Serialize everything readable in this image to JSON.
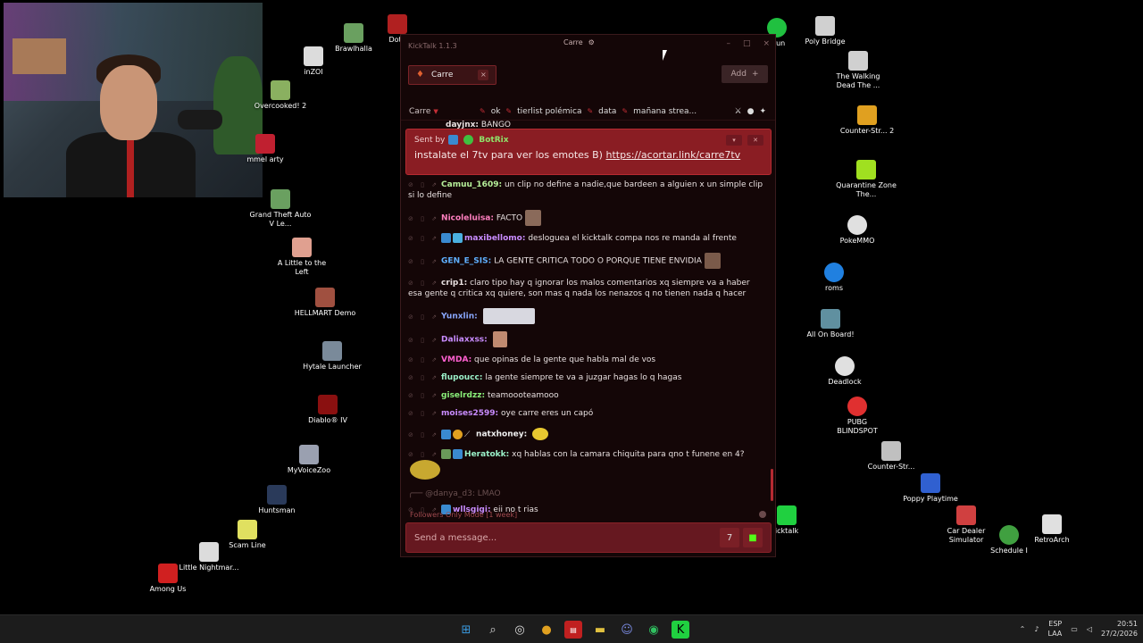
{
  "desktop_icons": [
    {
      "label": "Brawlhalla",
      "color": "#6aa060"
    },
    {
      "label": "Dota",
      "color": "#b02020"
    },
    {
      "label": "inZOI",
      "color": "#dcdcdc"
    },
    {
      "label": "Overcooked! 2",
      "color": "#8ab060"
    },
    {
      "label": "mmel arty",
      "color": "#c02030"
    },
    {
      "label": "Grand Theft Auto V Le...",
      "color": "#6aa060"
    },
    {
      "label": "A Little to the Left",
      "color": "#e0a090"
    },
    {
      "label": "HELLMART Demo",
      "color": "#a05040"
    },
    {
      "label": "Hytale Launcher",
      "color": "#7a8a9a"
    },
    {
      "label": "Diablo® IV",
      "color": "#8a1010"
    },
    {
      "label": "MyVoiceZoo",
      "color": "#9aa0b0"
    },
    {
      "label": "Huntsman",
      "color": "#2a3a5a"
    },
    {
      "label": "Scam Line",
      "color": "#e0e060"
    },
    {
      "label": "Little Nightmar...",
      "color": "#dcdcdc"
    },
    {
      "label": "Among Us",
      "color": "#d02020"
    },
    {
      "label": "drun",
      "color": "#20c040"
    },
    {
      "label": "Poly Bridge",
      "color": "#d0d0d0"
    },
    {
      "label": "The Walking Dead The ...",
      "color": "#d0d0d0"
    },
    {
      "label": "Counter-Str... 2",
      "color": "#e0a020"
    },
    {
      "label": "Quarantine Zone The...",
      "color": "#a0e020"
    },
    {
      "label": "PokeMMO",
      "color": "#e0e0e0"
    },
    {
      "label": "roms",
      "color": "#2080e0"
    },
    {
      "label": "All On Board!",
      "color": "#6090a0"
    },
    {
      "label": "Deadlock",
      "color": "#e0e0e0"
    },
    {
      "label": "PUBG BLINDSPOT",
      "color": "#e03030"
    },
    {
      "label": "Counter-Str...",
      "color": "#c0c0c0"
    },
    {
      "label": "Poppy Playtime",
      "color": "#3060d0"
    },
    {
      "label": "Car Dealer Simulator",
      "color": "#d04040"
    },
    {
      "label": "Schedule I",
      "color": "#40a040"
    },
    {
      "label": "RetroArch",
      "color": "#e0e0e0"
    },
    {
      "label": "icktalk",
      "color": "#20d040"
    }
  ],
  "kicktalk": {
    "title": "KickTalk 1.1.3",
    "center_channel": "Carre",
    "tab_label": "Carre",
    "add_label": "Add",
    "channel_name": "Carre",
    "pins": [
      "ok",
      "tierlist polémica",
      "data",
      "mañana strea..."
    ],
    "pinned": {
      "sent_by": "Sent by",
      "bot": "BotRix",
      "text": "instalate el 7tv para ver los emotes B)",
      "link": "https://acortar.link/carre7tv"
    },
    "messages": [
      {
        "user": "dayjnx:",
        "text": "BANGO",
        "color": "#e8e0e0"
      },
      {
        "user": "Camuu_1609:",
        "text": "un clip no define a nadie,que bardeen a alguien x un simple clip si lo define",
        "color": "#b6f09a"
      },
      {
        "user": "Nicoleluisa:",
        "text": "FACTO",
        "color": "#ff7fbf"
      },
      {
        "user": "maxibellomo:",
        "text": "desloguea el kicktalk compa nos re manda al frente",
        "color": "#c98cff"
      },
      {
        "user": "GEN_E_SIS:",
        "text": "LA GENTE CRITICA TODO O PORQUE TIENE ENVIDIA",
        "color": "#5fb0ff"
      },
      {
        "user": "crip1:",
        "text": "claro tipo hay q ignorar los malos comentarios xq siempre va a haber esa gente q critica xq quiere, son mas q nada los nenazos q no tienen nada q hacer",
        "color": "#e8e0e0"
      },
      {
        "user": "Yunxlin:",
        "text": "",
        "color": "#8aa8ff"
      },
      {
        "user": "Daliaxxss:",
        "text": "",
        "color": "#c98cff"
      },
      {
        "user": "VMDA:",
        "text": "que opinas de la gente que habla mal de vos",
        "color": "#ff60d0"
      },
      {
        "user": "flupoucc:",
        "text": "la gente siempre te va a juzgar hagas lo q hagas",
        "color": "#9af0c8"
      },
      {
        "user": "giselrdzz:",
        "text": "teamoooteamooo",
        "color": "#8af07a"
      },
      {
        "user": "moises2599:",
        "text": "oye carre eres un capó",
        "color": "#c98cff"
      },
      {
        "user": "natxhoney:",
        "text": "",
        "color": "#f0f0f0"
      },
      {
        "user": "Heratokk:",
        "text": "xq hablas con la camara chiquita para qno t funene en 4?",
        "color": "#9af0c8"
      }
    ],
    "reply": {
      "to": "@danya_d3:",
      "text": "LMAO"
    },
    "last": {
      "user": "wllsgigi:",
      "text": "eii no t rias",
      "color": "#c98cff"
    },
    "followers_mode": "Followers Only Mode [1 week]",
    "input_placeholder": "Send a message..."
  },
  "taskbar": {
    "lang": "ESP",
    "region": "LAA",
    "time": "20:51",
    "date": "27/2/2026"
  }
}
